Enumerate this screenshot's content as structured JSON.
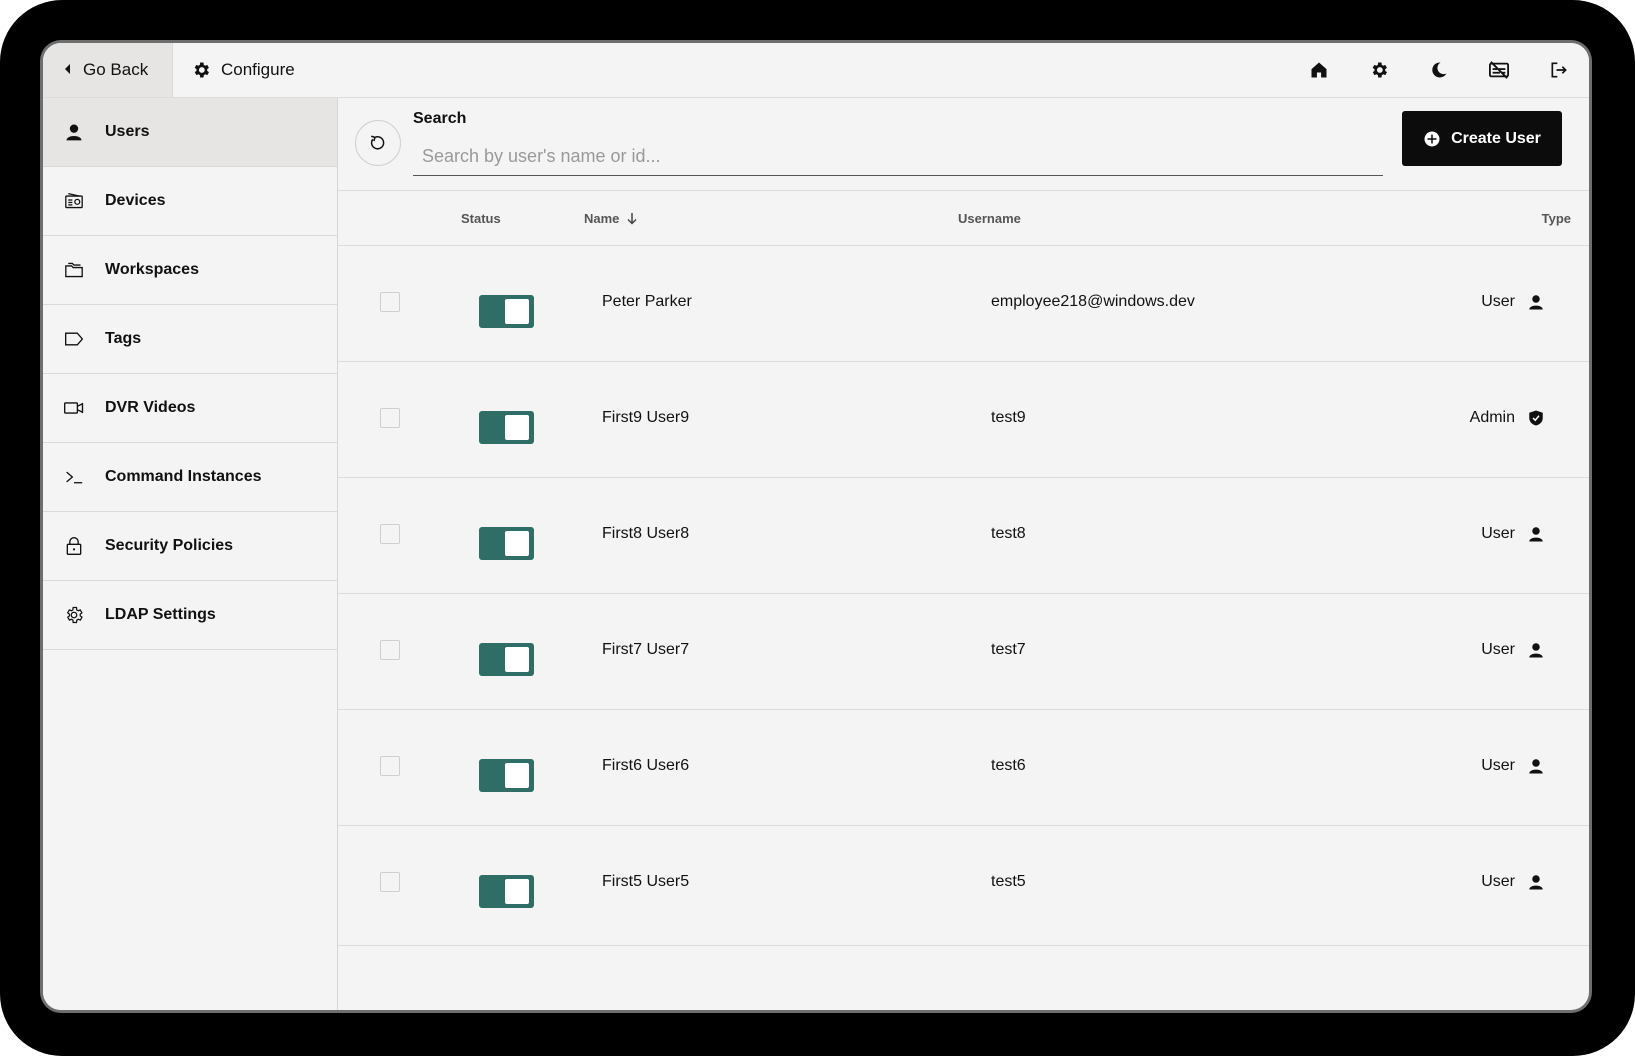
{
  "topbar": {
    "back_label": "Go Back",
    "configure_label": "Configure",
    "icons": [
      "home-icon",
      "settings-icon",
      "dark-mode-icon",
      "captions-off-icon",
      "logout-icon"
    ]
  },
  "sidebar": {
    "items": [
      {
        "label": "Users",
        "icon": "user-icon",
        "active": true
      },
      {
        "label": "Devices",
        "icon": "device-icon"
      },
      {
        "label": "Workspaces",
        "icon": "folder-icon"
      },
      {
        "label": "Tags",
        "icon": "tag-icon"
      },
      {
        "label": "DVR Videos",
        "icon": "video-icon"
      },
      {
        "label": "Command Instances",
        "icon": "terminal-icon"
      },
      {
        "label": "Security Policies",
        "icon": "lock-icon"
      },
      {
        "label": "LDAP Settings",
        "icon": "gear-icon"
      }
    ]
  },
  "search": {
    "label": "Search",
    "placeholder": "Search by user's name or id...",
    "value": ""
  },
  "create_button": "Create User",
  "table": {
    "headers": {
      "status": "Status",
      "name": "Name",
      "username": "Username",
      "type": "Type"
    },
    "sort": {
      "column": "name",
      "direction": "descending"
    },
    "rows": [
      {
        "name": "Peter Parker",
        "username": "employee218@windows.dev",
        "type": "User",
        "enabled": true,
        "checked": false
      },
      {
        "name": "First9 User9",
        "username": "test9",
        "type": "Admin",
        "enabled": true,
        "checked": false
      },
      {
        "name": "First8 User8",
        "username": "test8",
        "type": "User",
        "enabled": true,
        "checked": false
      },
      {
        "name": "First7 User7",
        "username": "test7",
        "type": "User",
        "enabled": true,
        "checked": false
      },
      {
        "name": "First6 User6",
        "username": "test6",
        "type": "User",
        "enabled": true,
        "checked": false
      },
      {
        "name": "First5 User5",
        "username": "test5",
        "type": "User",
        "enabled": true,
        "checked": false
      }
    ]
  },
  "colors": {
    "accent": "#2f6e66",
    "active_nav": "#e6e5e3",
    "button": "#0c0c0c"
  }
}
